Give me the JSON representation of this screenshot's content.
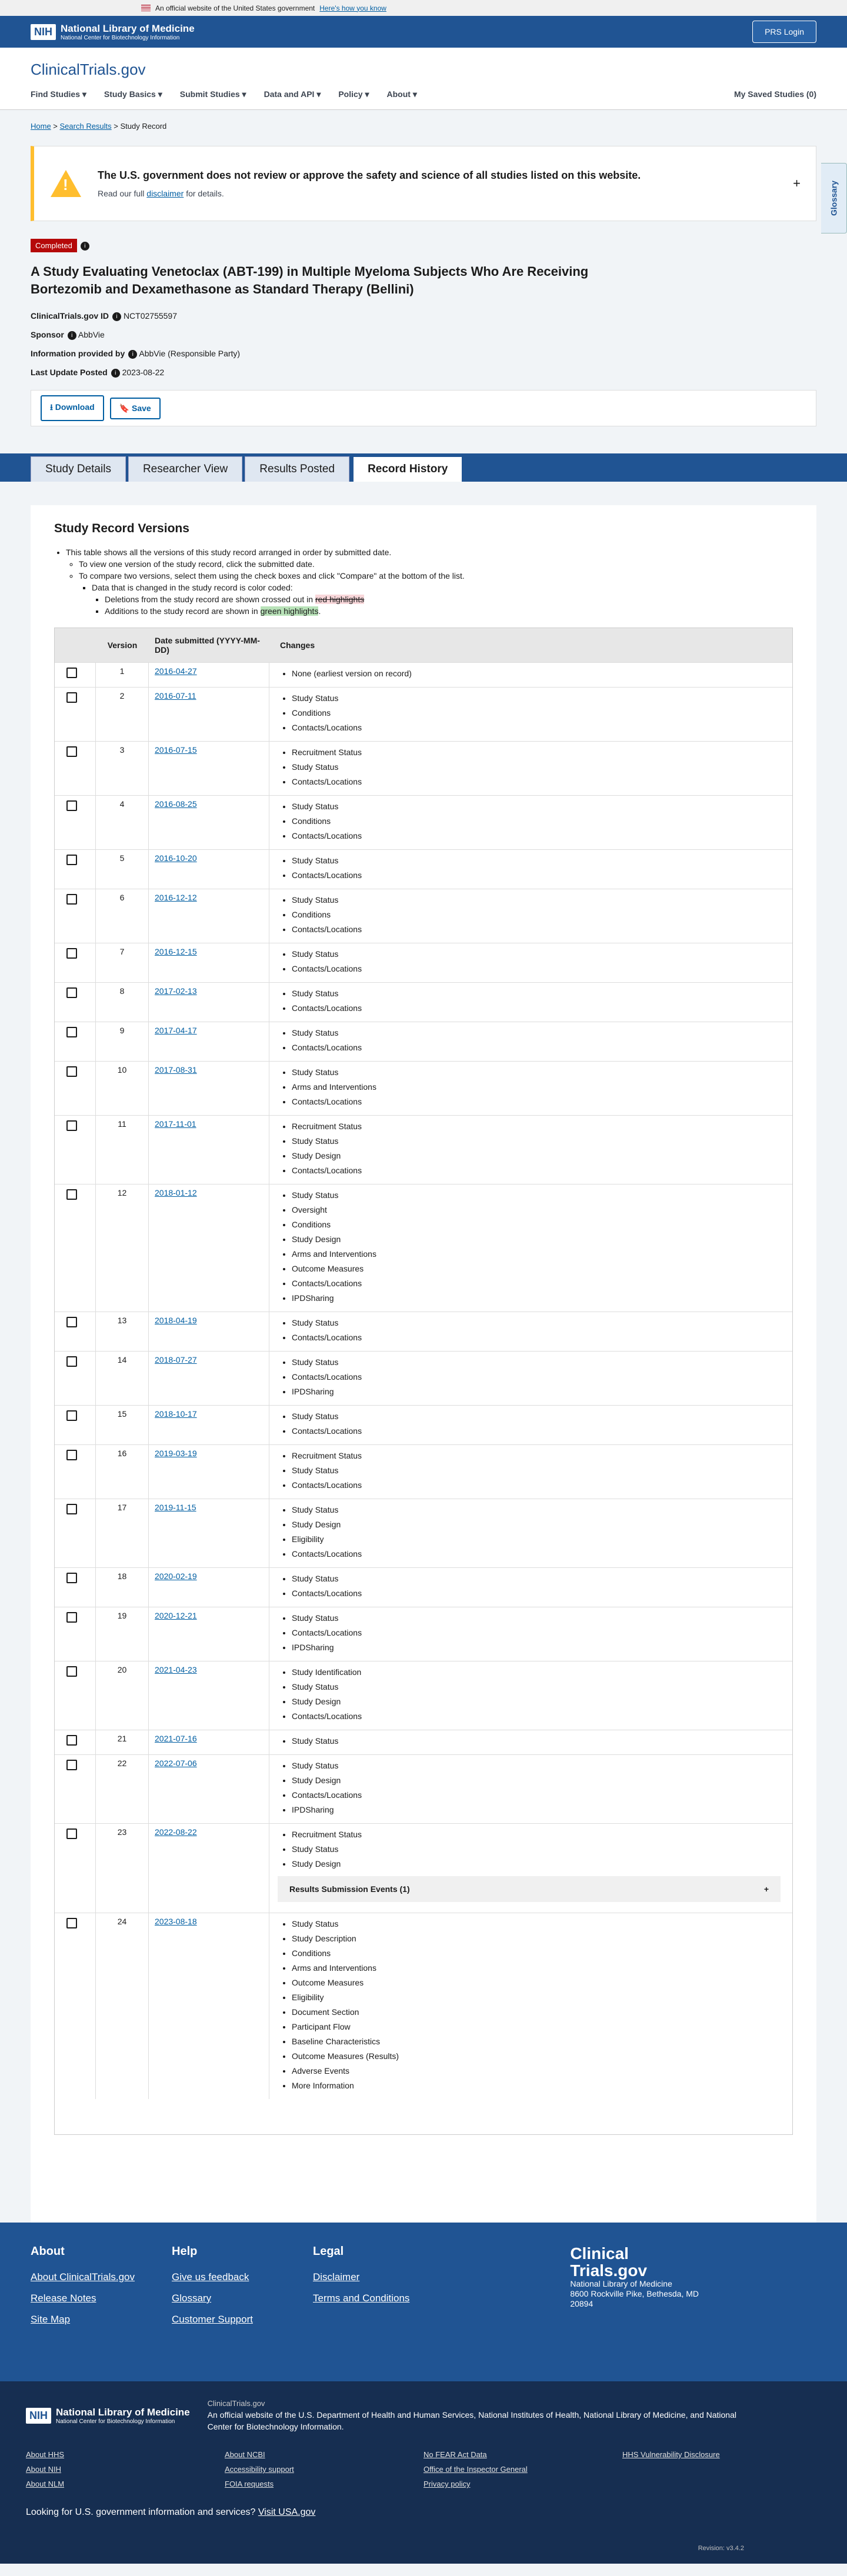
{
  "gov_banner": {
    "text": "An official website of the United States government",
    "link": "Here's how you know"
  },
  "nih": {
    "name": "National Library of Medicine",
    "sub": "National Center for Biotechnology Information",
    "prs": "PRS Login"
  },
  "site": {
    "logo": "ClinicalTrials",
    "logo2": ".gov",
    "nav": [
      "Find Studies",
      "Study Basics",
      "Submit Studies",
      "Data and API",
      "Policy",
      "About"
    ],
    "saved": "My Saved Studies (0)",
    "glossary": "Glossary"
  },
  "breadcrumb": {
    "home": "Home",
    "search": "Search Results",
    "current": "Study Record"
  },
  "warning": {
    "heading": "The U.S. government does not review or approve the safety and science of all studies listed on this website.",
    "pre": "Read our full",
    "link": "disclaimer",
    "post": "for details."
  },
  "study": {
    "status": "Completed",
    "title": "A Study Evaluating Venetoclax (ABT-199) in Multiple Myeloma Subjects Who Are Receiving Bortezomib and Dexamethasone as Standard Therapy (Bellini)",
    "id_label": "ClinicalTrials.gov ID",
    "id": "NCT02755597",
    "sponsor_label": "Sponsor",
    "sponsor": "AbbVie",
    "info_label": "Information provided by",
    "info": "AbbVie (Responsible Party)",
    "update_label": "Last Update Posted",
    "update": "2023-08-22",
    "download": "Download",
    "save": "Save"
  },
  "tabs": [
    "Study Details",
    "Researcher View",
    "Results Posted",
    "Record History"
  ],
  "versions": {
    "heading": "Study Record Versions",
    "b1": "This table shows all the versions of this study record arranged in order by submitted date.",
    "b2": "To view one version of the study record, click the submitted date.",
    "b3": "To compare two versions, select them using the check boxes and click \"Compare\" at the bottom of the list.",
    "b4": "Data that is changed in the study record is color coded:",
    "b5a": "Deletions from the study record are shown crossed out in",
    "b5b": "red highlights",
    "b6a": "Additions to the study record are shown in",
    "b6b": "green highlights",
    "h_version": "Version",
    "h_date": "Date submitted (YYYY-MM-DD)",
    "h_changes": "Changes",
    "rse": "Results Submission Events (1)",
    "rows": [
      [
        "1",
        "2016-04-27",
        [
          "None (earliest version on record)"
        ]
      ],
      [
        "2",
        "2016-07-11",
        [
          "Study Status",
          "Conditions",
          "Contacts/Locations"
        ]
      ],
      [
        "3",
        "2016-07-15",
        [
          "Recruitment Status",
          "Study Status",
          "Contacts/Locations"
        ]
      ],
      [
        "4",
        "2016-08-25",
        [
          "Study Status",
          "Conditions",
          "Contacts/Locations"
        ]
      ],
      [
        "5",
        "2016-10-20",
        [
          "Study Status",
          "Contacts/Locations"
        ]
      ],
      [
        "6",
        "2016-12-12",
        [
          "Study Status",
          "Conditions",
          "Contacts/Locations"
        ]
      ],
      [
        "7",
        "2016-12-15",
        [
          "Study Status",
          "Contacts/Locations"
        ]
      ],
      [
        "8",
        "2017-02-13",
        [
          "Study Status",
          "Contacts/Locations"
        ]
      ],
      [
        "9",
        "2017-04-17",
        [
          "Study Status",
          "Contacts/Locations"
        ]
      ],
      [
        "10",
        "2017-08-31",
        [
          "Study Status",
          "Arms and Interventions",
          "Contacts/Locations"
        ]
      ],
      [
        "11",
        "2017-11-01",
        [
          "Recruitment Status",
          "Study Status",
          "Study Design",
          "Contacts/Locations"
        ]
      ],
      [
        "12",
        "2018-01-12",
        [
          "Study Status",
          "Oversight",
          "Conditions",
          "Study Design",
          "Arms and Interventions",
          "Outcome Measures",
          "Contacts/Locations",
          "IPDSharing"
        ]
      ],
      [
        "13",
        "2018-04-19",
        [
          "Study Status",
          "Contacts/Locations"
        ]
      ],
      [
        "14",
        "2018-07-27",
        [
          "Study Status",
          "Contacts/Locations",
          "IPDSharing"
        ]
      ],
      [
        "15",
        "2018-10-17",
        [
          "Study Status",
          "Contacts/Locations"
        ]
      ],
      [
        "16",
        "2019-03-19",
        [
          "Recruitment Status",
          "Study Status",
          "Contacts/Locations"
        ]
      ],
      [
        "17",
        "2019-11-15",
        [
          "Study Status",
          "Study Design",
          "Eligibility",
          "Contacts/Locations"
        ]
      ],
      [
        "18",
        "2020-02-19",
        [
          "Study Status",
          "Contacts/Locations"
        ]
      ],
      [
        "19",
        "2020-12-21",
        [
          "Study Status",
          "Contacts/Locations",
          "IPDSharing"
        ]
      ],
      [
        "20",
        "2021-04-23",
        [
          "Study Identification",
          "Study Status",
          "Study Design",
          "Contacts/Locations"
        ]
      ],
      [
        "21",
        "2021-07-16",
        [
          "Study Status"
        ]
      ],
      [
        "22",
        "2022-07-06",
        [
          "Study Status",
          "Study Design",
          "Contacts/Locations",
          "IPDSharing"
        ]
      ],
      [
        "23",
        "2022-08-22",
        [
          "Recruitment Status",
          "Study Status",
          "Study Design"
        ]
      ],
      [
        "24",
        "2023-08-18",
        [
          "Study Status",
          "Study Description",
          "Conditions",
          "Arms and Interventions",
          "Outcome Measures",
          "Eligibility",
          "Document Section",
          "Participant Flow",
          "Baseline Characteristics",
          "Outcome Measures (Results)",
          "Adverse Events",
          "More Information"
        ]
      ]
    ]
  },
  "footer": {
    "about_h": "About",
    "about": [
      "About ClinicalTrials.gov",
      "Release Notes",
      "Site Map"
    ],
    "help_h": "Help",
    "help": [
      "Give us feedback",
      "Glossary",
      "Customer Support"
    ],
    "legal_h": "Legal",
    "legal": [
      "Disclaimer",
      "Terms and Conditions"
    ],
    "brand1": "Clinical",
    "brand2": "Trials.gov",
    "addr1": "National Library of Medicine",
    "addr2": "8600 Rockville Pike, Bethesda, MD",
    "addr3": "20894",
    "site": "ClinicalTrials.gov",
    "official": "An official website of the U.S. Department of Health and Human Services, National Institutes of Health, National Library of Medicine, and National Center for Biotechnology Information.",
    "links": [
      [
        "About HHS",
        "About NIH",
        "About NLM"
      ],
      [
        "About NCBI",
        "Accessibility support",
        "FOIA requests"
      ],
      [
        "No FEAR Act Data",
        "Office of the Inspector General",
        "Privacy policy"
      ],
      [
        "HHS Vulnerability Disclosure"
      ]
    ],
    "usa_pre": "Looking for U.S. government information and services?",
    "usa_link": "Visit USA.gov",
    "version": "Revision: v3.4.2"
  }
}
